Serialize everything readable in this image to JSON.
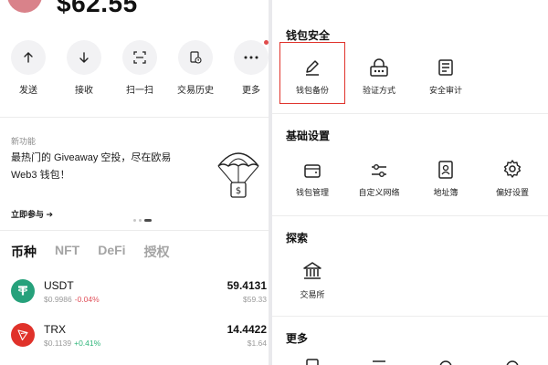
{
  "wallet": {
    "balance": "$62.55",
    "actions": [
      {
        "label": "发送",
        "icon": "arrow-up-icon"
      },
      {
        "label": "接收",
        "icon": "arrow-down-icon"
      },
      {
        "label": "扫一扫",
        "icon": "scan-icon"
      },
      {
        "label": "交易历史",
        "icon": "history-icon"
      },
      {
        "label": "更多",
        "icon": "more-icon"
      }
    ],
    "promo": {
      "tag": "新功能",
      "text": "最热门的 Giveaway 空投，尽在欧易 Web3 钱包！",
      "link": "立即参与 ➔"
    },
    "tabs": [
      "币种",
      "NFT",
      "DeFi",
      "授权"
    ],
    "tokens": [
      {
        "symbol": "USDT",
        "price": "$0.9986",
        "change": "-0.04%",
        "amount": "59.4131",
        "value": "$59.33",
        "color": "#26a17b"
      },
      {
        "symbol": "TRX",
        "price": "$0.1139",
        "change": "+0.41%",
        "amount": "14.4422",
        "value": "$1.64",
        "color": "#e0322a"
      }
    ]
  },
  "settings": {
    "security": {
      "title": "钱包安全",
      "items": [
        {
          "label": "钱包备份",
          "icon": "pencil-icon"
        },
        {
          "label": "验证方式",
          "icon": "keypad-icon"
        },
        {
          "label": "安全审计",
          "icon": "document-icon"
        }
      ]
    },
    "basic": {
      "title": "基础设置",
      "items": [
        {
          "label": "钱包管理",
          "icon": "wallet-icon"
        },
        {
          "label": "自定义网络",
          "icon": "sliders-icon"
        },
        {
          "label": "地址簿",
          "icon": "contact-book-icon"
        },
        {
          "label": "偏好设置",
          "icon": "gear-icon"
        }
      ]
    },
    "explore": {
      "title": "探索",
      "items": [
        {
          "label": "交易所",
          "icon": "bank-icon"
        }
      ]
    },
    "more": {
      "title": "更多"
    }
  },
  "colors": {
    "highlight": "#e0332c",
    "positive": "#2fb57a",
    "negative": "#e0505a"
  }
}
